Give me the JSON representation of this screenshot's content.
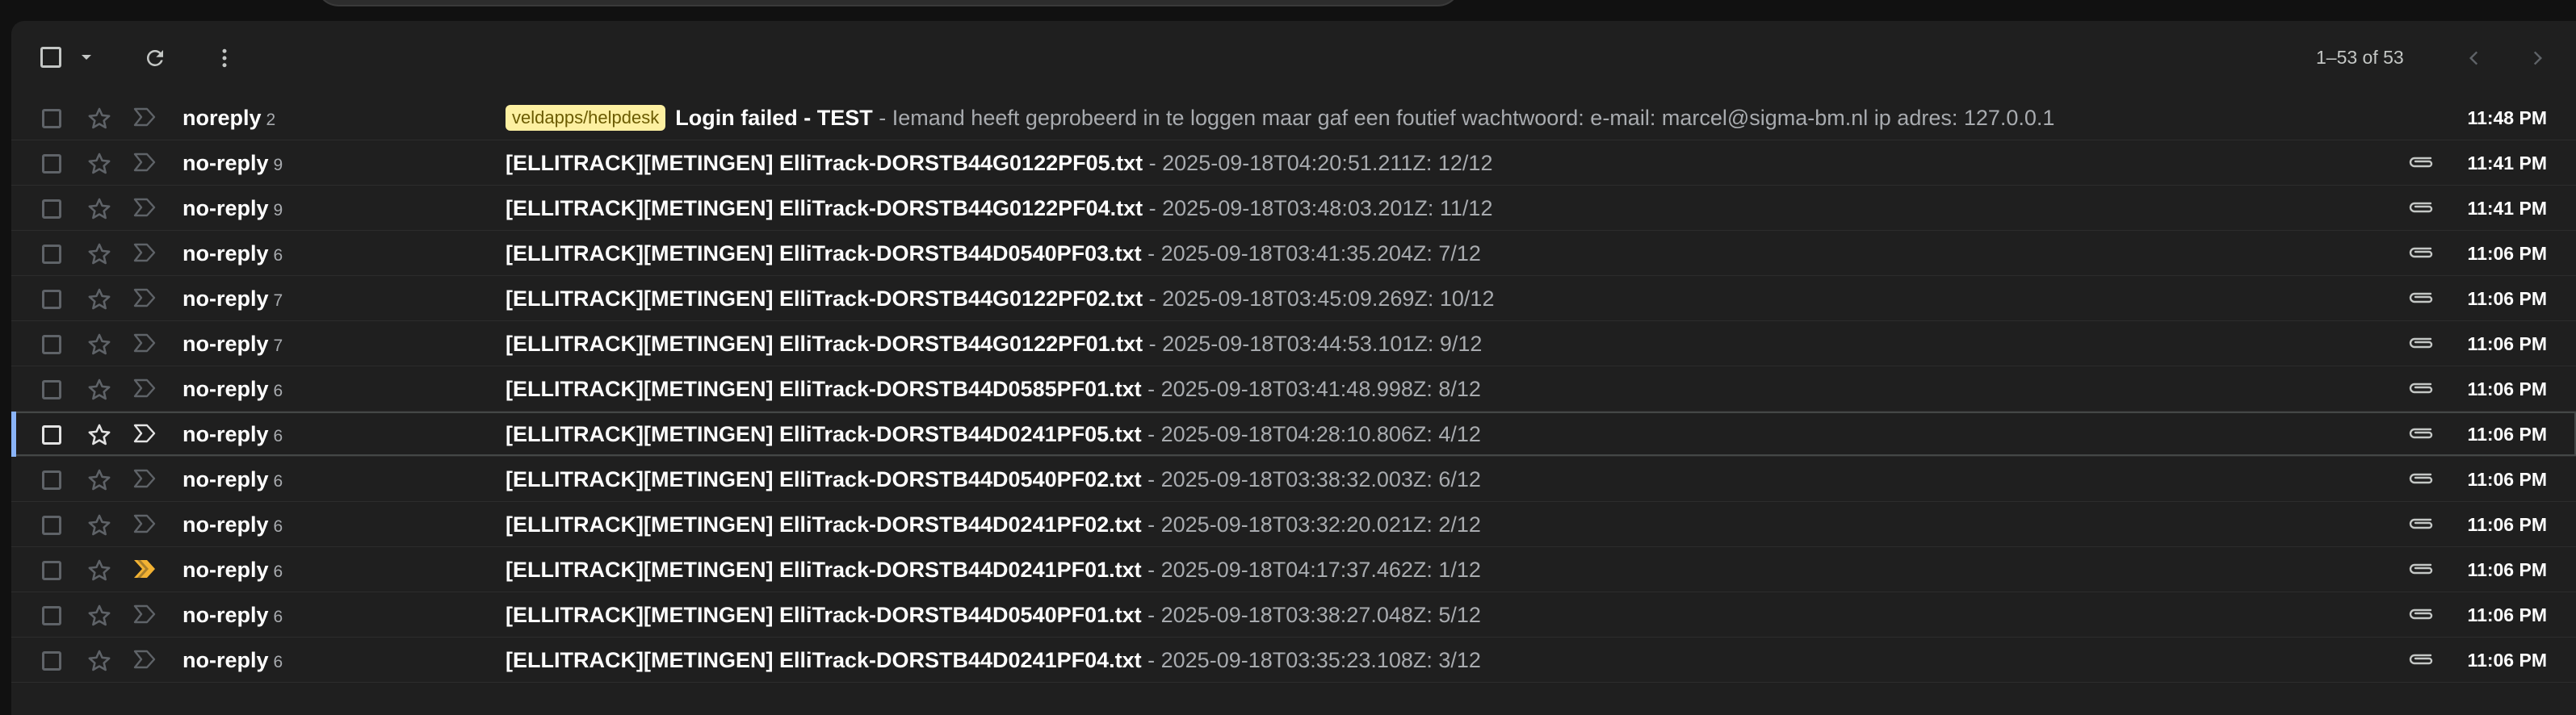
{
  "toolbar": {
    "page_count": "1–53 of 53",
    "icons": [
      "select-all-checkbox",
      "select-dropdown-icon",
      "refresh-icon",
      "more-options-icon",
      "previous-page-icon",
      "next-page-icon"
    ]
  },
  "colors": {
    "background": "#1f1f1f",
    "label_badge_bg": "#fdf0a1",
    "important_marker": "#f2b233",
    "selected_accent": "#8ab4f8"
  },
  "emails": [
    {
      "sender": "noreply",
      "count": "2",
      "label": "veldapps/helpdesk",
      "subject": "Login failed - TEST",
      "snippet": " - Iemand heeft geprobeerd in te loggen maar gaf een foutief wachtwoord: e-mail: marcel@sigma-bm.nl ip adres: 127.0.0.1",
      "time": "11:48 PM",
      "attachment": false,
      "important": false,
      "selected": false
    },
    {
      "sender": "no-reply",
      "count": "9",
      "label": "",
      "subject": "[ELLITRACK][METINGEN] ElliTrack-DORSTB44G0122PF05.txt",
      "snippet": " - 2025-09-18T04:20:51.211Z: 12/12",
      "time": "11:41 PM",
      "attachment": true,
      "important": false,
      "selected": false
    },
    {
      "sender": "no-reply",
      "count": "9",
      "label": "",
      "subject": "[ELLITRACK][METINGEN] ElliTrack-DORSTB44G0122PF04.txt",
      "snippet": " - 2025-09-18T03:48:03.201Z: 11/12",
      "time": "11:41 PM",
      "attachment": true,
      "important": false,
      "selected": false
    },
    {
      "sender": "no-reply",
      "count": "6",
      "label": "",
      "subject": "[ELLITRACK][METINGEN] ElliTrack-DORSTB44D0540PF03.txt",
      "snippet": " - 2025-09-18T03:41:35.204Z: 7/12",
      "time": "11:06 PM",
      "attachment": true,
      "important": false,
      "selected": false
    },
    {
      "sender": "no-reply",
      "count": "7",
      "label": "",
      "subject": "[ELLITRACK][METINGEN] ElliTrack-DORSTB44G0122PF02.txt",
      "snippet": " - 2025-09-18T03:45:09.269Z: 10/12",
      "time": "11:06 PM",
      "attachment": true,
      "important": false,
      "selected": false
    },
    {
      "sender": "no-reply",
      "count": "7",
      "label": "",
      "subject": "[ELLITRACK][METINGEN] ElliTrack-DORSTB44G0122PF01.txt",
      "snippet": " - 2025-09-18T03:44:53.101Z: 9/12",
      "time": "11:06 PM",
      "attachment": true,
      "important": false,
      "selected": false
    },
    {
      "sender": "no-reply",
      "count": "6",
      "label": "",
      "subject": "[ELLITRACK][METINGEN] ElliTrack-DORSTB44D0585PF01.txt",
      "snippet": " - 2025-09-18T03:41:48.998Z: 8/12",
      "time": "11:06 PM",
      "attachment": true,
      "important": false,
      "selected": false
    },
    {
      "sender": "no-reply",
      "count": "6",
      "label": "",
      "subject": "[ELLITRACK][METINGEN] ElliTrack-DORSTB44D0241PF05.txt",
      "snippet": " - 2025-09-18T04:28:10.806Z: 4/12",
      "time": "11:06 PM",
      "attachment": true,
      "important": false,
      "selected": true
    },
    {
      "sender": "no-reply",
      "count": "6",
      "label": "",
      "subject": "[ELLITRACK][METINGEN] ElliTrack-DORSTB44D0540PF02.txt",
      "snippet": " - 2025-09-18T03:38:32.003Z: 6/12",
      "time": "11:06 PM",
      "attachment": true,
      "important": false,
      "selected": false
    },
    {
      "sender": "no-reply",
      "count": "6",
      "label": "",
      "subject": "[ELLITRACK][METINGEN] ElliTrack-DORSTB44D0241PF02.txt",
      "snippet": " - 2025-09-18T03:32:20.021Z: 2/12",
      "time": "11:06 PM",
      "attachment": true,
      "important": false,
      "selected": false
    },
    {
      "sender": "no-reply",
      "count": "6",
      "label": "",
      "subject": "[ELLITRACK][METINGEN] ElliTrack-DORSTB44D0241PF01.txt",
      "snippet": " - 2025-09-18T04:17:37.462Z: 1/12",
      "time": "11:06 PM",
      "attachment": true,
      "important": true,
      "selected": false
    },
    {
      "sender": "no-reply",
      "count": "6",
      "label": "",
      "subject": "[ELLITRACK][METINGEN] ElliTrack-DORSTB44D0540PF01.txt",
      "snippet": " - 2025-09-18T03:38:27.048Z: 5/12",
      "time": "11:06 PM",
      "attachment": true,
      "important": false,
      "selected": false
    },
    {
      "sender": "no-reply",
      "count": "6",
      "label": "",
      "subject": "[ELLITRACK][METINGEN] ElliTrack-DORSTB44D0241PF04.txt",
      "snippet": " - 2025-09-18T03:35:23.108Z: 3/12",
      "time": "11:06 PM",
      "attachment": true,
      "important": false,
      "selected": false
    }
  ]
}
